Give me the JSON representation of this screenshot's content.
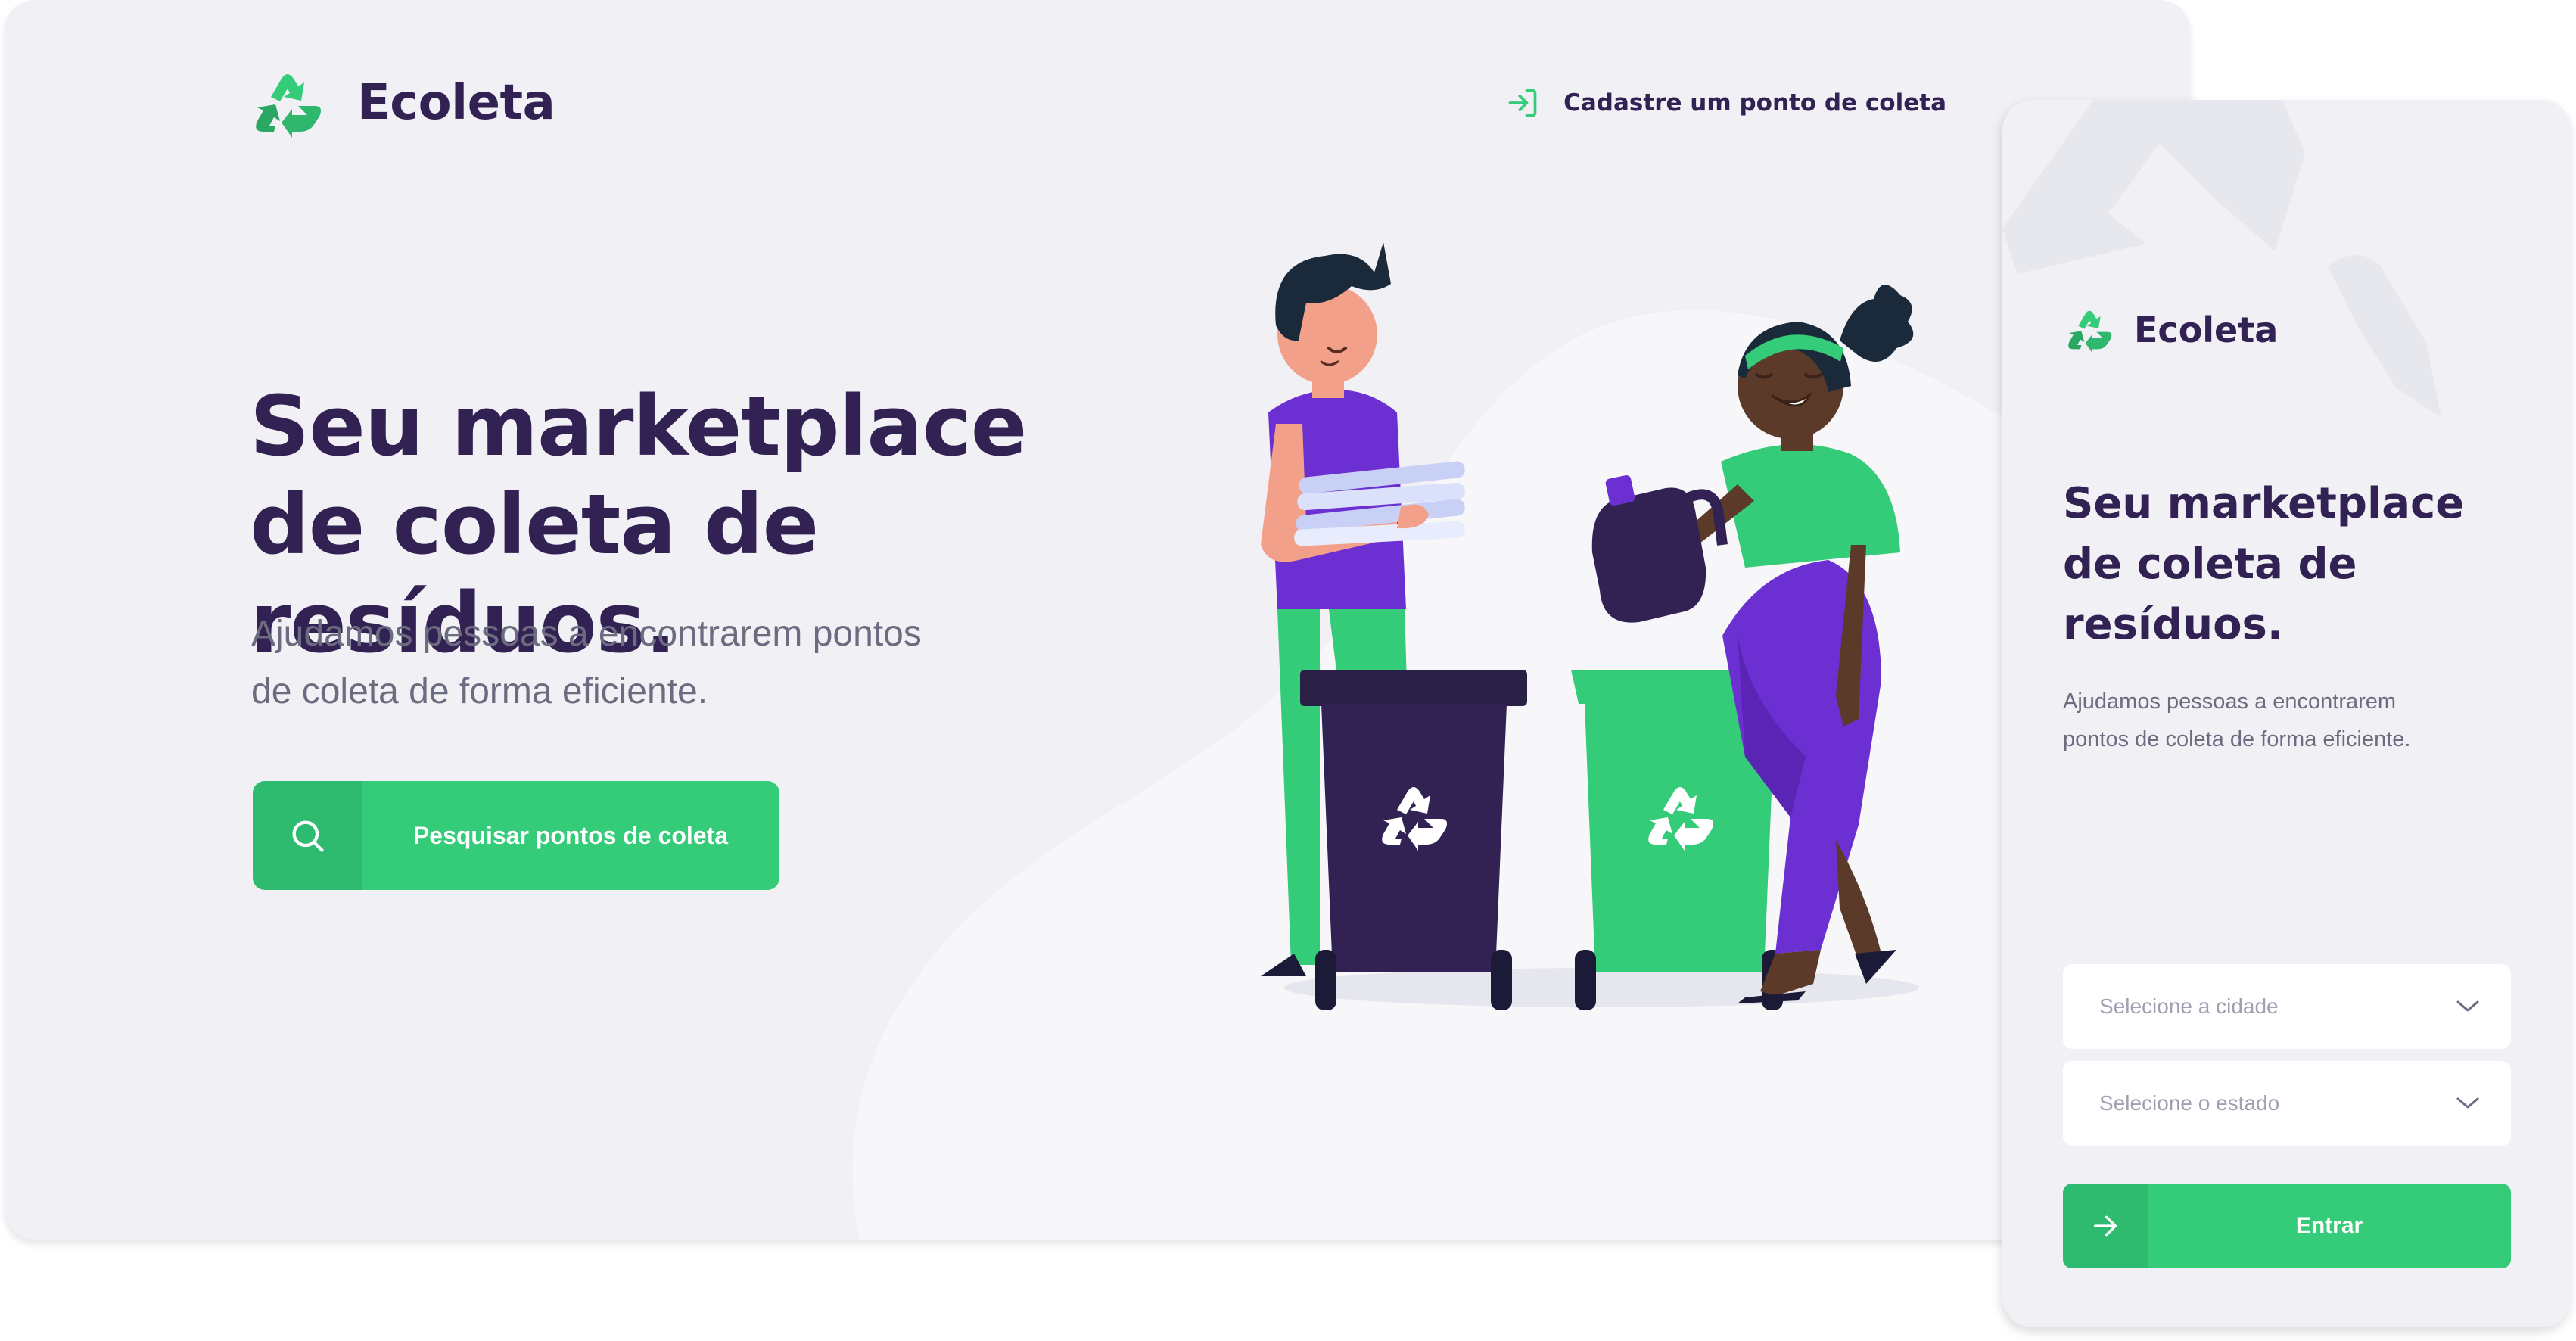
{
  "colors": {
    "primary": "#34cb79",
    "title": "#322153",
    "text": "#6c6c80",
    "background": "#f0f0f5",
    "placeholder": "#a0a0b2"
  },
  "desktop": {
    "logo": {
      "icon": "recycle-icon",
      "text": "Ecoleta"
    },
    "register_link": {
      "icon": "log-in-icon",
      "label": "Cadastre um ponto de coleta"
    },
    "hero": {
      "title_line1": "Seu marketplace",
      "title_line2": "de coleta de resíduos.",
      "subtitle_line1": "Ajudamos pessoas a encontrarem pontos",
      "subtitle_line2": "de coleta de forma eficiente."
    },
    "search_button": {
      "icon": "search-icon",
      "label": "Pesquisar pontos de coleta"
    },
    "illustration": "people-recycling-illustration"
  },
  "mobile": {
    "logo": {
      "icon": "recycle-icon",
      "text": "Ecoleta"
    },
    "title_line1": "Seu marketplace",
    "title_line2": "de coleta de",
    "title_line3": "resíduos.",
    "subtitle_line1": "Ajudamos pessoas a encontrarem",
    "subtitle_line2": "pontos de coleta de forma eficiente.",
    "city_select": {
      "placeholder": "Selecione a cidade",
      "icon": "chevron-down-icon"
    },
    "state_select": {
      "placeholder": "Selecione o estado",
      "icon": "chevron-down-icon"
    },
    "enter_button": {
      "icon": "arrow-right-icon",
      "label": "Entrar"
    }
  }
}
